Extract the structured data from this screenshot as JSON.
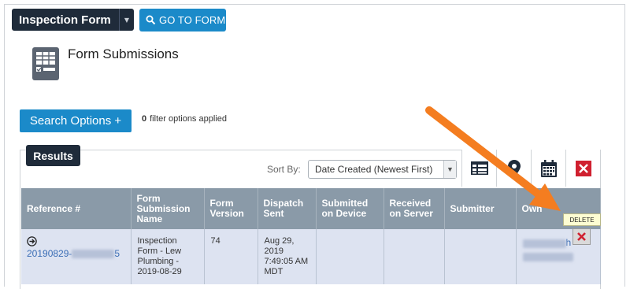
{
  "header": {
    "form_select_label": "Inspection Form",
    "goto_label": "GO TO FORM"
  },
  "page": {
    "title": "Form Submissions"
  },
  "filters": {
    "search_label": "Search Options +",
    "count": "0",
    "text": "filter options applied"
  },
  "results": {
    "tab_label": "Results",
    "sort_label": "Sort By:",
    "sort_value": "Date Created (Newest First)",
    "view_buttons": [
      "table-view-icon",
      "map-pin-icon",
      "calendar-icon",
      "delete-icon"
    ],
    "columns": [
      "Reference #",
      "Form Submission Name",
      "Form Version",
      "Dispatch Sent",
      "Submitted on Device",
      "Received on Server",
      "Submitter",
      "Own"
    ],
    "rows": [
      {
        "ref_prefix": "20190829-",
        "ref_suffix": "5",
        "submission_name": "Inspection Form - Lew Plumbing - 2019-08-29",
        "version": "74",
        "dispatch_sent": "Aug 29, 2019 7:49:05 AM MDT",
        "submitted_on_device": "",
        "received_on_server": "",
        "submitter": "",
        "owner_partial": "h"
      }
    ],
    "delete_tooltip": "DELETE"
  },
  "colors": {
    "dark_navy": "#1f2b3a",
    "primary_blue": "#1b8ac9",
    "header_gray": "#8a9aa8",
    "row_blue": "#dde3f1",
    "delete_red": "#d0202f",
    "annotation_orange": "#f47d20"
  }
}
